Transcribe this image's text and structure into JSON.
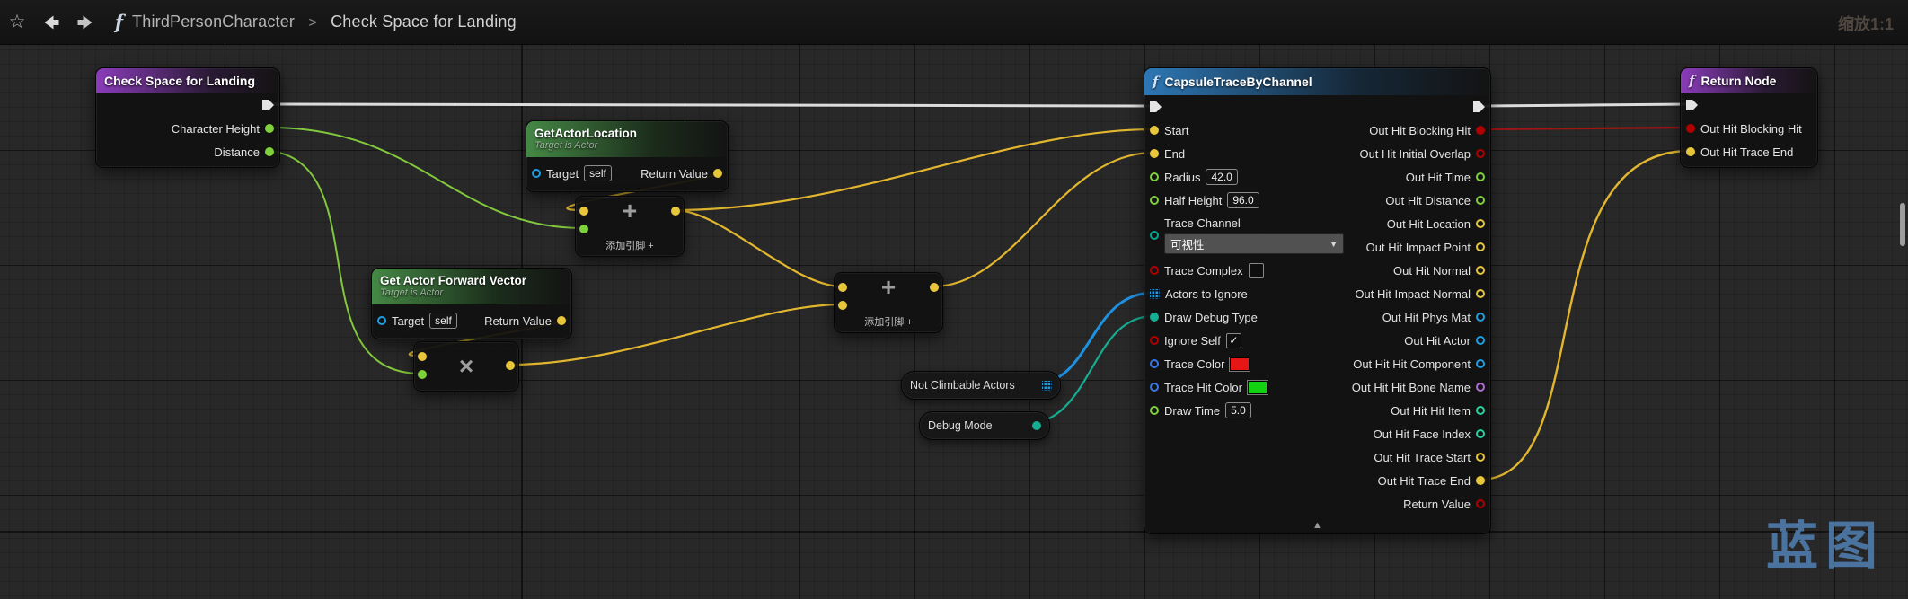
{
  "toolbar": {
    "breadcrumb": {
      "parent": "ThirdPersonCharacter",
      "current": "Check Space for Landing"
    },
    "zoom_label": "缩放1:1"
  },
  "icons": {
    "function": "f",
    "favorite": "☆",
    "separator": ">",
    "dropdown_arrow": "▼",
    "collapse_arrow": "▲",
    "check_mark": "✓",
    "add_symbol": "+",
    "multiply_symbol": "×"
  },
  "graph": {
    "watermark": "蓝图"
  },
  "nodes": {
    "check_space": {
      "title": "Check Space for Landing",
      "outputs": [
        "Character Height",
        "Distance"
      ]
    },
    "get_actor_location": {
      "title": "GetActorLocation",
      "subtitle": "Target is Actor",
      "input_label": "Target",
      "input_value": "self",
      "output_label": "Return Value"
    },
    "get_forward_vector": {
      "title": "Get Actor Forward Vector",
      "subtitle": "Target is Actor",
      "input_label": "Target",
      "input_value": "self",
      "output_label": "Return Value"
    },
    "add_node_1": {
      "add_pin": "添加引脚 +"
    },
    "add_node_2": {
      "add_pin": "添加引脚 +"
    },
    "not_climbable": {
      "title": "Not Climbable Actors"
    },
    "debug_mode": {
      "title": "Debug Mode"
    },
    "capsule_trace": {
      "title": "CapsuleTraceByChannel",
      "inputs": [
        {
          "label": "Start"
        },
        {
          "label": "End"
        },
        {
          "label": "Radius",
          "value": "42.0"
        },
        {
          "label": "Half Height",
          "value": "96.0"
        },
        {
          "label": "Trace Channel",
          "value": "可视性"
        },
        {
          "label": "Trace Complex"
        },
        {
          "label": "Actors to Ignore"
        },
        {
          "label": "Draw Debug Type"
        },
        {
          "label": "Ignore Self"
        },
        {
          "label": "Trace Color"
        },
        {
          "label": "Trace Hit Color"
        },
        {
          "label": "Draw Time",
          "value": "5.0"
        }
      ],
      "outputs": [
        "Out Hit Blocking Hit",
        "Out Hit Initial Overlap",
        "Out Hit Time",
        "Out Hit Distance",
        "Out Hit Location",
        "Out Hit Impact Point",
        "Out Hit Normal",
        "Out Hit Impact Normal",
        "Out Hit Phys Mat",
        "Out Hit Actor",
        "Out Hit Hit Component",
        "Out Hit Hit Bone Name",
        "Out Hit Hit Item",
        "Out Hit Face Index",
        "Out Hit Trace Start",
        "Out Hit Trace End",
        "Return Value"
      ]
    },
    "return_node": {
      "title": "Return Node",
      "inputs": [
        "Out Hit Blocking Hit",
        "Out Hit Trace End"
      ]
    }
  },
  "colors": {
    "exec_wire": "#dcdcdc",
    "vector": "#e8c63c",
    "float": "#7fd13b",
    "bool": "#b00000",
    "object": "#1e9ee0",
    "enum": "#00a98f",
    "name": "#b06ad4",
    "int": "#27d1a0",
    "color_struct": "#3a76e8",
    "trace_color_value": "#e61616",
    "trace_hit_color_value": "#12d212",
    "header_function": "#2f7cbd",
    "header_pure": "#488e48",
    "header_entry": "#923ec4"
  }
}
